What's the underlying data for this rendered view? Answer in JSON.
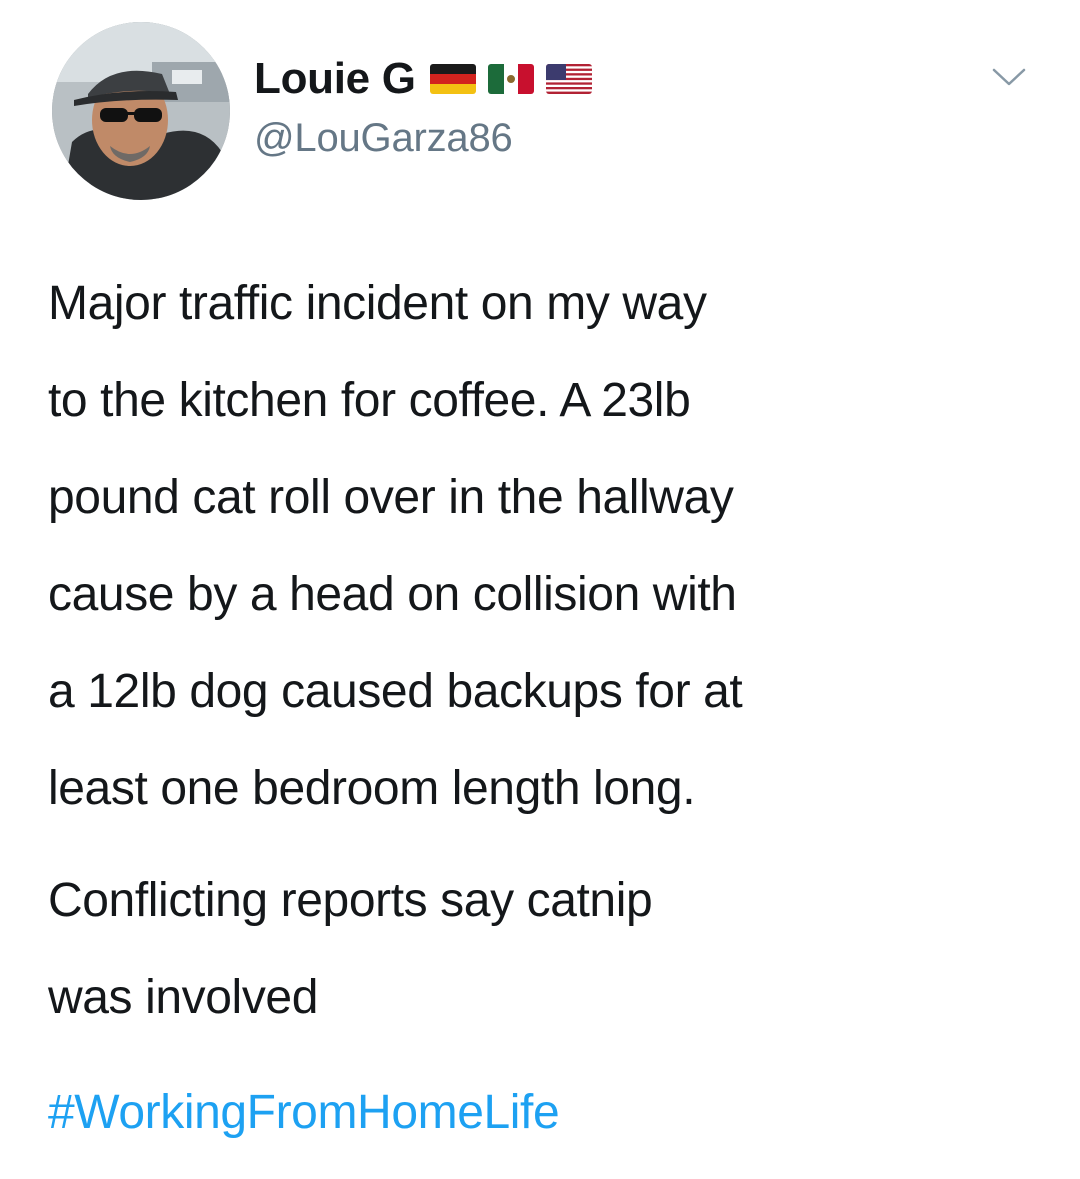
{
  "author": {
    "display_name": "Louie G",
    "handle": "@LouGarza86",
    "flags": [
      "germany-flag",
      "mexico-flag",
      "usa-flag"
    ],
    "avatar": "profile-photo"
  },
  "menu": {
    "icon": "chevron-down-icon"
  },
  "tweet": {
    "paragraph_1": "Major traffic incident on my way\nto the kitchen for coffee. A 23lb\npound cat roll over in the hallway\ncause by a head on collision with\na 12lb dog caused backups for at\nleast one bedroom length long.",
    "paragraph_2": "Conflicting reports say catnip\nwas involved",
    "hashtag": "#WorkingFromHomeLife"
  },
  "colors": {
    "text": "#14171a",
    "secondary": "#657786",
    "link": "#1da1f2"
  }
}
